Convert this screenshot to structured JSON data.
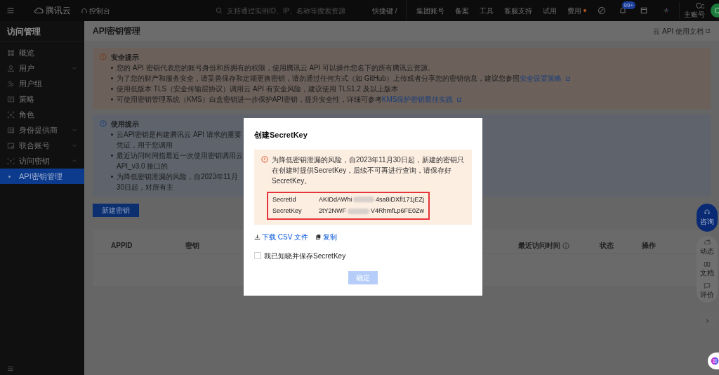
{
  "top_bar": {
    "brand": "腾讯云",
    "console": "控制台",
    "search": {
      "placeholder": "支持通过实例ID、IP、名称等搜索资源"
    },
    "shortcut": "快捷键 /",
    "nav": [
      {
        "label": "集团账号",
        "dot": false
      },
      {
        "label": "备案",
        "dot": false
      },
      {
        "label": "工具",
        "dot": false
      },
      {
        "label": "客服支持",
        "dot": false
      },
      {
        "label": "试用",
        "dot": false
      },
      {
        "label": "费用",
        "dot": true
      }
    ],
    "notification_badge": "99+",
    "account": {
      "name": "Cc",
      "role": "主账号",
      "avatar": "C"
    }
  },
  "sidebar": {
    "title": "访问管理",
    "items": [
      {
        "label": "概览",
        "kind": "link",
        "selected": false
      },
      {
        "label": "用户",
        "kind": "group",
        "selected": false,
        "expanded": false
      },
      {
        "label": "用户组",
        "kind": "link",
        "selected": false
      },
      {
        "label": "策略",
        "kind": "link",
        "selected": false
      },
      {
        "label": "角色",
        "kind": "link",
        "selected": false
      },
      {
        "label": "身份提供商",
        "kind": "group",
        "selected": false,
        "expanded": false
      },
      {
        "label": "联合账号",
        "kind": "group",
        "selected": false,
        "expanded": false
      },
      {
        "label": "访问密钥",
        "kind": "group",
        "selected": false,
        "expanded": true,
        "children": [
          {
            "label": "API密钥管理",
            "kind": "link",
            "selected": true
          }
        ]
      }
    ]
  },
  "page": {
    "title": "API密钥管理",
    "doc_link": "云 API 使用文档"
  },
  "security_notice": {
    "title": "安全提示",
    "items": [
      {
        "text": "您的 API 密钥代表您的账号身份和所拥有的权限，使用腾讯云 API 可以操作您名下的所有腾讯云资源。"
      },
      {
        "text": "为了您的财产和服务安全，请妥善保存和定期更换密钥，请勿通过任何方式（如 GitHub）上传或者分享您的密钥信息，建议您参照",
        "link": "安全设置策略"
      },
      {
        "text": "使用低版本 TLS（安全传输层协议）调用云 API 有安全风险，建议使用 TLS1.2 及以上版本"
      },
      {
        "text": "可使用密钥管理系统（KMS）白盒密钥进一步保护API密钥，提升安全性，详细可参考",
        "link": "KMS保护密钥最佳实践"
      }
    ]
  },
  "usage_notice": {
    "title": "使用提示",
    "items": [
      {
        "text": "云API密钥是构建腾讯云 API 请求的重要凭证，用于您调用"
      },
      {
        "text": "最近访问时间指最近一次使用密钥调用云 API_v3.0 接口的"
      },
      {
        "text": "为降低密钥泄漏的风险，自2023年11月30日起，对所有主"
      }
    ]
  },
  "new_key_button": "新建密钥",
  "table": {
    "columns": [
      {
        "label": "APPID",
        "info": false
      },
      {
        "label": "密钥",
        "info": false
      },
      {
        "label": "最近访问时间",
        "info": true
      },
      {
        "label": "状态",
        "info": false
      },
      {
        "label": "操作",
        "info": false
      }
    ]
  },
  "modal": {
    "title": "创建SecretKey",
    "warning": "为降低密钥泄漏的风险，自2023年11月30日起，新建的密钥只在创建时提供SecretKey，后续不可再进行查询，请保存好SecretKey。",
    "credentials": [
      {
        "label": "SecretId",
        "value_start": "AKIDdAWhi",
        "value_end": "4sa8iDXfl171jEZj"
      },
      {
        "label": "SecretKey",
        "value_start": "2tY2NWF",
        "value_end": "V4RhmfLp6FE0Zw"
      }
    ],
    "actions": [
      {
        "kind": "download",
        "label": "下载 CSV 文件"
      },
      {
        "kind": "copy",
        "label": "复制"
      }
    ],
    "acknowledge": {
      "label": "我已知晓并保存SecretKey",
      "checked": false
    },
    "confirm": {
      "label": "确定",
      "disabled": true
    }
  },
  "float_panel": {
    "consult": "咨询",
    "items": [
      {
        "kind": "feed",
        "label": "动态"
      },
      {
        "kind": "docs",
        "label": "文档"
      },
      {
        "kind": "review",
        "label": "评价"
      }
    ]
  }
}
